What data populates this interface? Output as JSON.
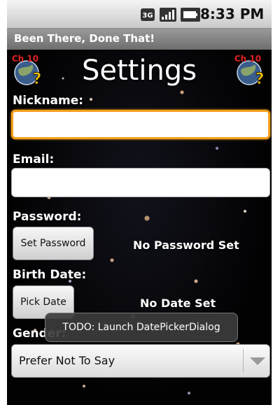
{
  "status_bar": {
    "time": "8:33 PM",
    "network": "3G"
  },
  "app": {
    "title": "Been There, Done That!"
  },
  "header": {
    "logo_text": "Ch 10",
    "logo_icon": "globe-question-icon",
    "title": "Settings"
  },
  "form": {
    "nickname": {
      "label": "Nickname:",
      "value": ""
    },
    "email": {
      "label": "Email:",
      "value": ""
    },
    "password": {
      "label": "Password:",
      "button": "Set Password",
      "status": "No Password Set"
    },
    "birth_date": {
      "label": "Birth Date:",
      "button": "Pick Date",
      "status": "No Date Set"
    },
    "gender": {
      "label": "Gender:",
      "selected": "Prefer Not To Say"
    }
  },
  "toast": {
    "text": "TODO: Launch DatePickerDialog"
  },
  "colors": {
    "focus": "#f5a11c",
    "titlebar": "#7e7e7e",
    "background": "#050507"
  }
}
